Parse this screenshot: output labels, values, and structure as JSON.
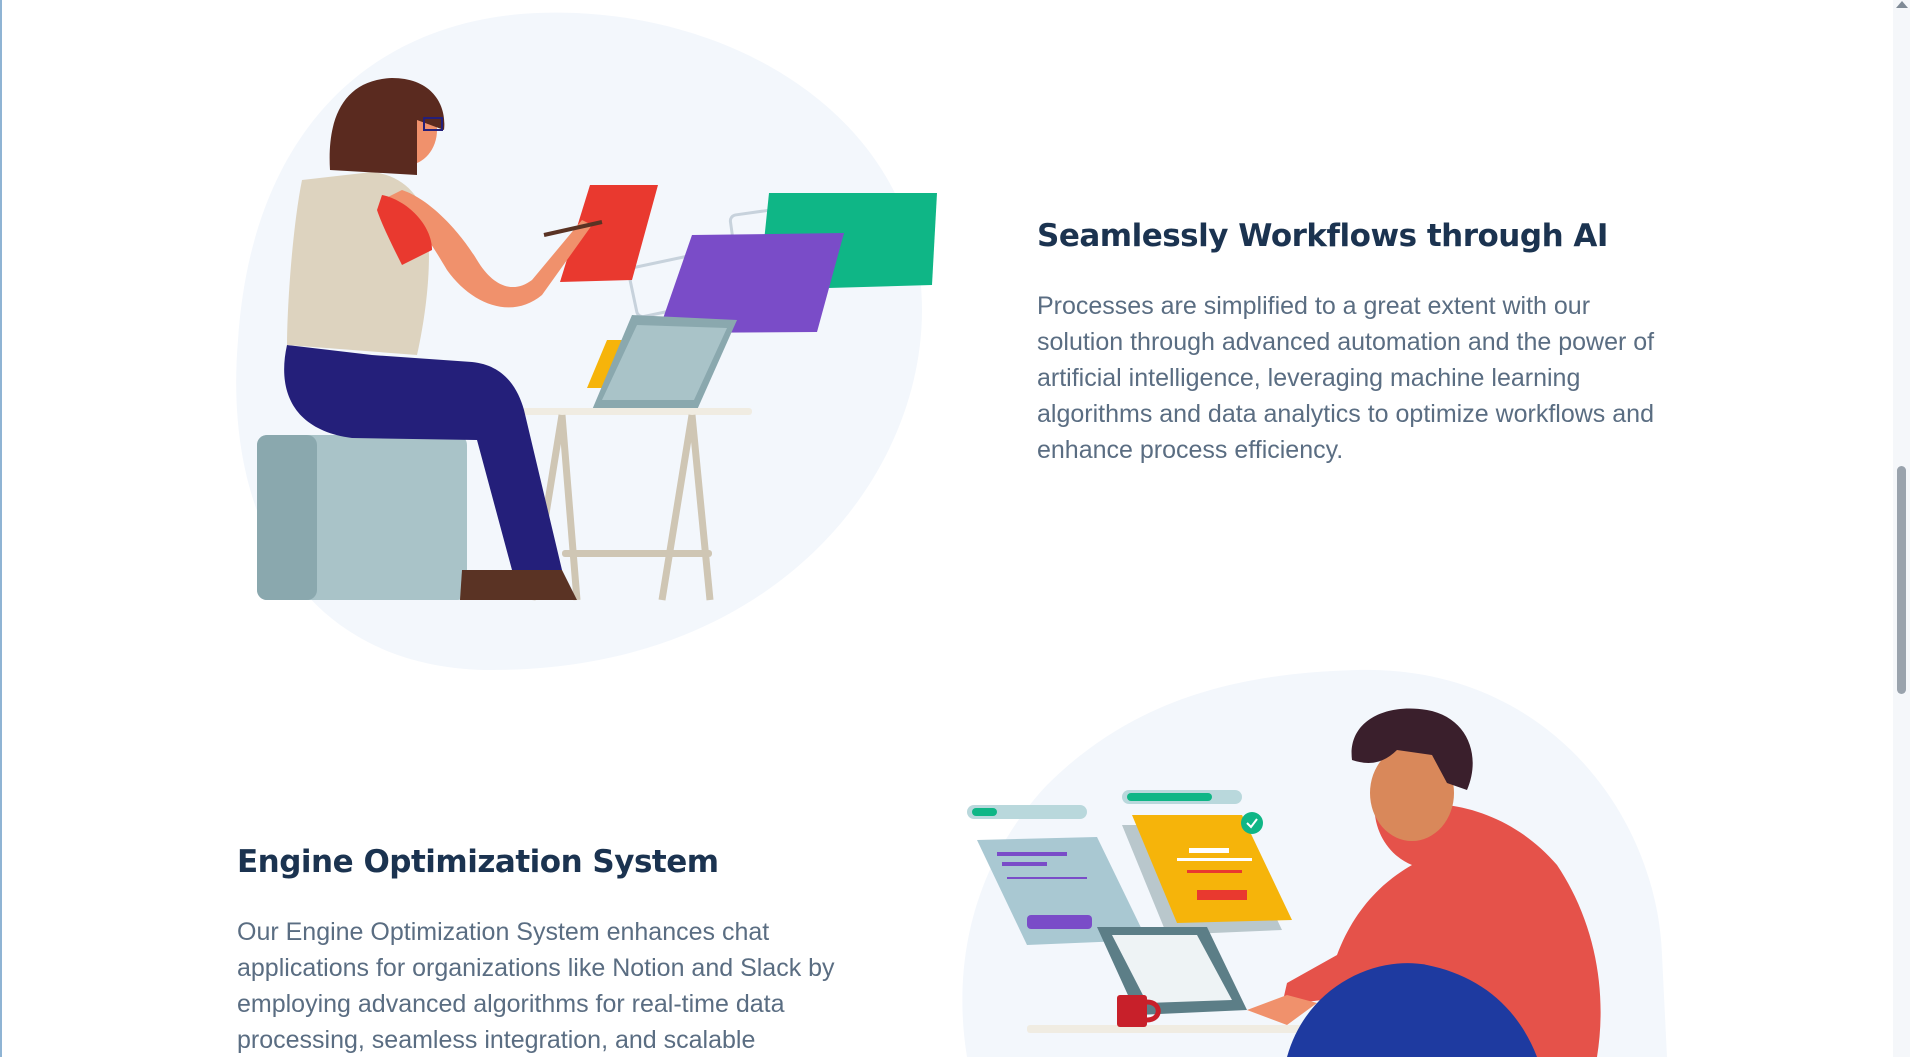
{
  "sections": [
    {
      "heading": "Seamlessly Workflows through AI",
      "body": "Processes are simplified to a great extent with our solution through advanced automation and the power of artificial intelligence, leveraging machine learning algorithms and data analytics to optimize workflows and enhance process efficiency."
    },
    {
      "heading": "Engine Optimization System",
      "body": "Our Engine Optimization System enhances chat applications for organizations like Notion and Slack by employing advanced algorithms for real-time data processing, seamless integration, and scalable"
    }
  ],
  "illustrations": [
    {
      "icon": "woman-with-floating-cards-illustration"
    },
    {
      "icon": "man-with-laptop-illustration"
    }
  ],
  "colors": {
    "heading": "#1b3350",
    "body": "#5a6d82",
    "blob": "#f3f7fc",
    "red": "#e9392f",
    "green": "#0fb686",
    "purple": "#7a4cc8",
    "yellow": "#f6b40a",
    "navy": "#241f7a"
  }
}
